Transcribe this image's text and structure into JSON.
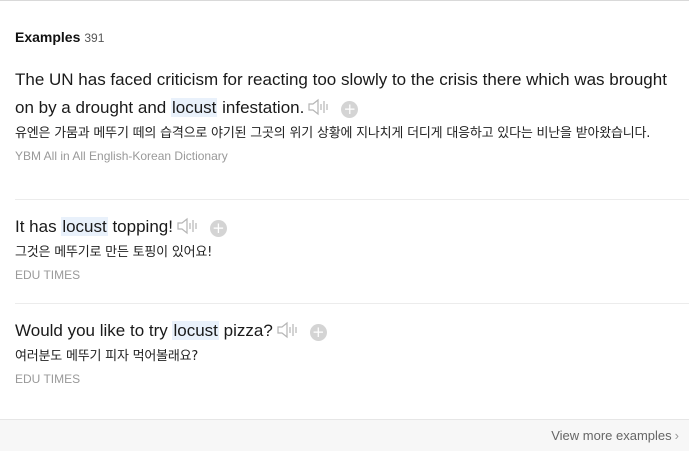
{
  "header": {
    "title": "Examples",
    "count": "391"
  },
  "examples": [
    {
      "en_before": "The UN has faced criticism for reacting too slowly to the crisis there which was brought on by a drought and ",
      "keyword": "locust",
      "en_after": " infestation.",
      "ko": "유엔은 가뭄과 메뚜기 떼의 습격으로 야기된 그곳의 위기 상황에 지나치게 더디게 대응하고 있다는 비난을 받아왔습니다.",
      "source": "YBM All in All English-Korean Dictionary"
    },
    {
      "en_before": "It has ",
      "keyword": "locust",
      "en_after": " topping!",
      "ko": "그것은 메뚜기로 만든 토핑이 있어요!",
      "source": "EDU TIMES"
    },
    {
      "en_before": "Would you like to try ",
      "keyword": "locust",
      "en_after": " pizza?",
      "ko": "여러분도 메뚜기 피자 먹어볼래요?",
      "source": "EDU TIMES"
    }
  ],
  "footer": {
    "more_label": "View more examples",
    "chevron": "›"
  },
  "icons": {
    "speaker": "speaker-icon",
    "add": "plus-circle-icon"
  },
  "colors": {
    "highlight": "#e9f1fb",
    "source_text": "#999999",
    "icon_gray": "#bdbdbd"
  }
}
